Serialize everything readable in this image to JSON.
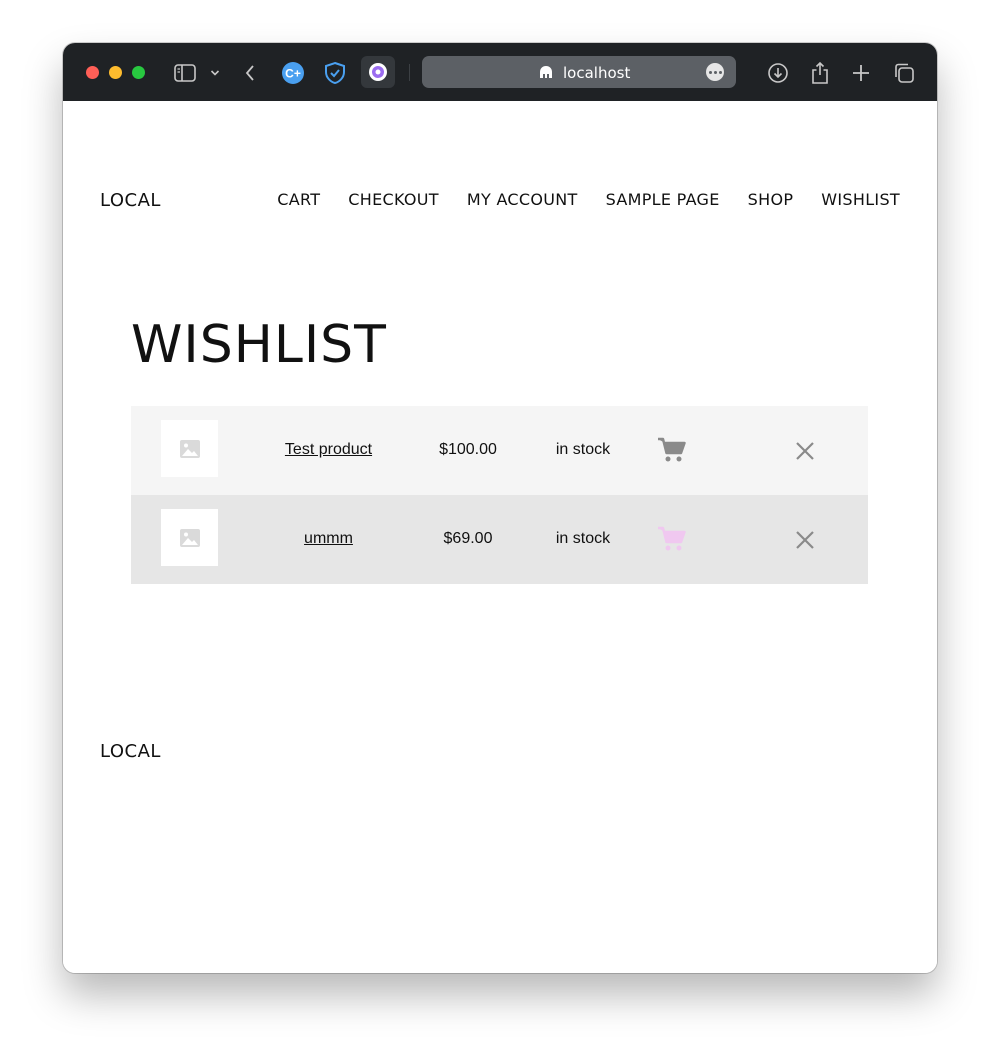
{
  "browser": {
    "url": "localhost",
    "colors": {
      "close": "#ff5f57",
      "minimize": "#febc2e",
      "maximize": "#28c840",
      "toolbar": "#1f2225"
    },
    "icons": [
      "sidebar-icon",
      "chevron-down-icon",
      "back-icon",
      "extension-c-plus-icon",
      "shield-check-icon",
      "extension-disc-icon",
      "site-icon",
      "more-icon",
      "download-icon",
      "share-icon",
      "new-tab-icon",
      "tab-overview-icon"
    ]
  },
  "header": {
    "site_title": "LOCAL",
    "nav": [
      "CART",
      "CHECKOUT",
      "MY ACCOUNT",
      "SAMPLE PAGE",
      "SHOP",
      "WISHLIST"
    ]
  },
  "page": {
    "heading": "WISHLIST"
  },
  "wishlist": {
    "rows": [
      {
        "name": "Test product",
        "price": "$100.00",
        "stock": "in stock",
        "cart_color": "#8a8a8a"
      },
      {
        "name": "ummm",
        "price": "$69.00",
        "stock": "in stock",
        "cart_color": "#f0c8f0"
      }
    ]
  },
  "footer": {
    "site_title": "LOCAL"
  }
}
